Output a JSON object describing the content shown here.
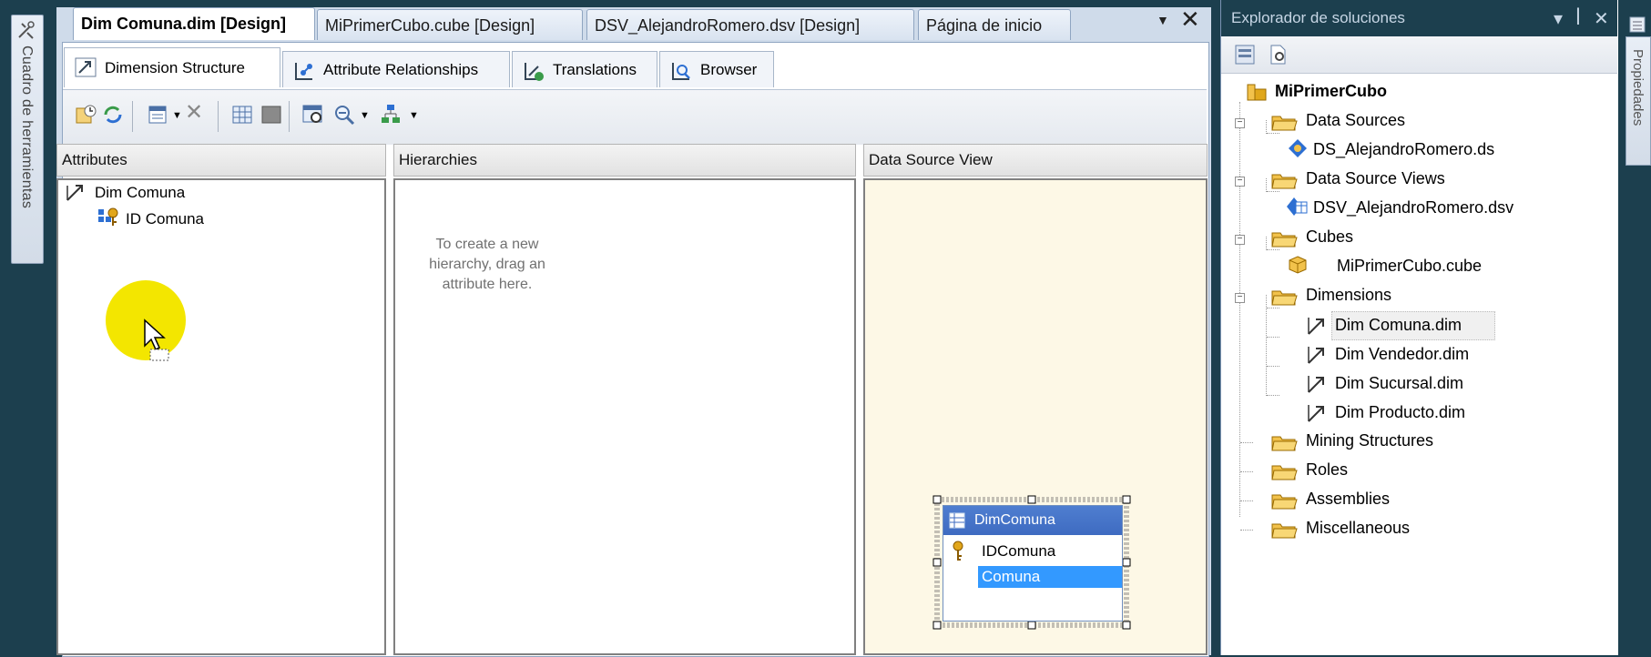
{
  "toolbox": {
    "label": "Cuadro de herramientas"
  },
  "document_tabs": [
    {
      "label": "Dim Comuna.dim [Design]"
    },
    {
      "label": "MiPrimerCubo.cube [Design]"
    },
    {
      "label": "DSV_AlejandroRomero.dsv [Design]"
    },
    {
      "label": "Página de inicio"
    }
  ],
  "designer_tabs": [
    {
      "label": "Dimension Structure",
      "icon": "dimension-structure-icon"
    },
    {
      "label": "Attribute Relationships",
      "icon": "attribute-relationships-icon"
    },
    {
      "label": "Translations",
      "icon": "translations-icon"
    },
    {
      "label": "Browser",
      "icon": "browser-icon"
    }
  ],
  "panes": {
    "attributes": {
      "header": "Attributes",
      "dimension": "Dim Comuna",
      "attribute": "ID Comuna"
    },
    "hierarchies": {
      "header": "Hierarchies",
      "hint": "To create a new hierarchy, drag an attribute here."
    },
    "data_source_view": {
      "header": "Data Source View",
      "table_title": "DimComuna",
      "columns": [
        "IDComuna",
        "Comuna"
      ]
    }
  },
  "solution_explorer": {
    "title": "Explorador de soluciones",
    "project": "MiPrimerCubo",
    "folders": [
      {
        "label": "Data Sources",
        "items": [
          "DS_AlejandroRomero.ds"
        ]
      },
      {
        "label": "Data Source Views",
        "items": [
          "DSV_AlejandroRomero.dsv"
        ]
      },
      {
        "label": "Cubes",
        "items": [
          "MiPrimerCubo.cube"
        ]
      },
      {
        "label": "Dimensions",
        "items": [
          "Dim Comuna.dim",
          "Dim Vendedor.dim",
          "Dim Sucursal.dim",
          "Dim Producto.dim"
        ]
      },
      {
        "label": "Mining Structures",
        "items": []
      },
      {
        "label": "Roles",
        "items": []
      },
      {
        "label": "Assemblies",
        "items": []
      },
      {
        "label": "Miscellaneous",
        "items": []
      }
    ]
  },
  "properties": {
    "label": "Propiedades"
  },
  "colors": {
    "background": "#1c3f4e",
    "dsv_header": "#3e6bc1",
    "selection": "#3399ff",
    "dsv_pane_bg": "#fdf8e6",
    "cursor_highlight": "#f3e600"
  }
}
